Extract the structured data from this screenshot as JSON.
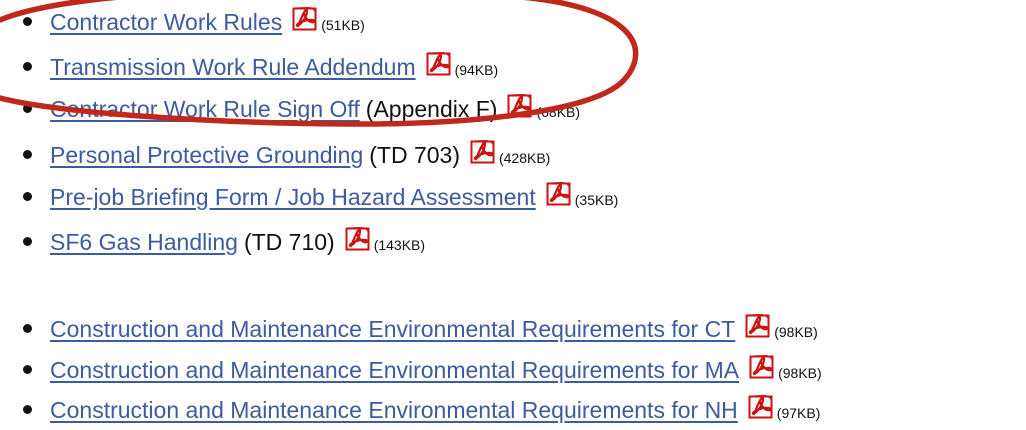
{
  "icon": "pdf-file-icon",
  "colors": {
    "link": "#3c5c9e",
    "pdf_icon": "#cc1111",
    "annotation_circle": "#c0281c"
  },
  "groups": [
    {
      "items": [
        {
          "link": "Contractor Work Rules",
          "suffix": "",
          "size": "(51KB)"
        },
        {
          "link": "Transmission Work Rule Addendum",
          "suffix": "",
          "size": "(94KB)"
        },
        {
          "link": "Contractor Work Rule Sign Off",
          "suffix": "(Appendix F)",
          "size": "(68KB)"
        },
        {
          "link": "Personal Protective Grounding",
          "suffix": "(TD 703)",
          "size": "(428KB)"
        },
        {
          "link": "Pre-job Briefing Form / Job Hazard Assessment",
          "suffix": "",
          "size": "(35KB)"
        },
        {
          "link": "SF6 Gas Handling",
          "suffix": "(TD 710)",
          "size": "(143KB)"
        }
      ]
    },
    {
      "items": [
        {
          "link": "Construction and Maintenance Environmental Requirements for CT",
          "suffix": "",
          "size": "(98KB)"
        },
        {
          "link": "Construction and Maintenance Environmental Requirements for MA",
          "suffix": "",
          "size": "(98KB)"
        },
        {
          "link": "Construction and Maintenance Environmental Requirements for NH",
          "suffix": "",
          "size": "(97KB)"
        }
      ]
    }
  ]
}
